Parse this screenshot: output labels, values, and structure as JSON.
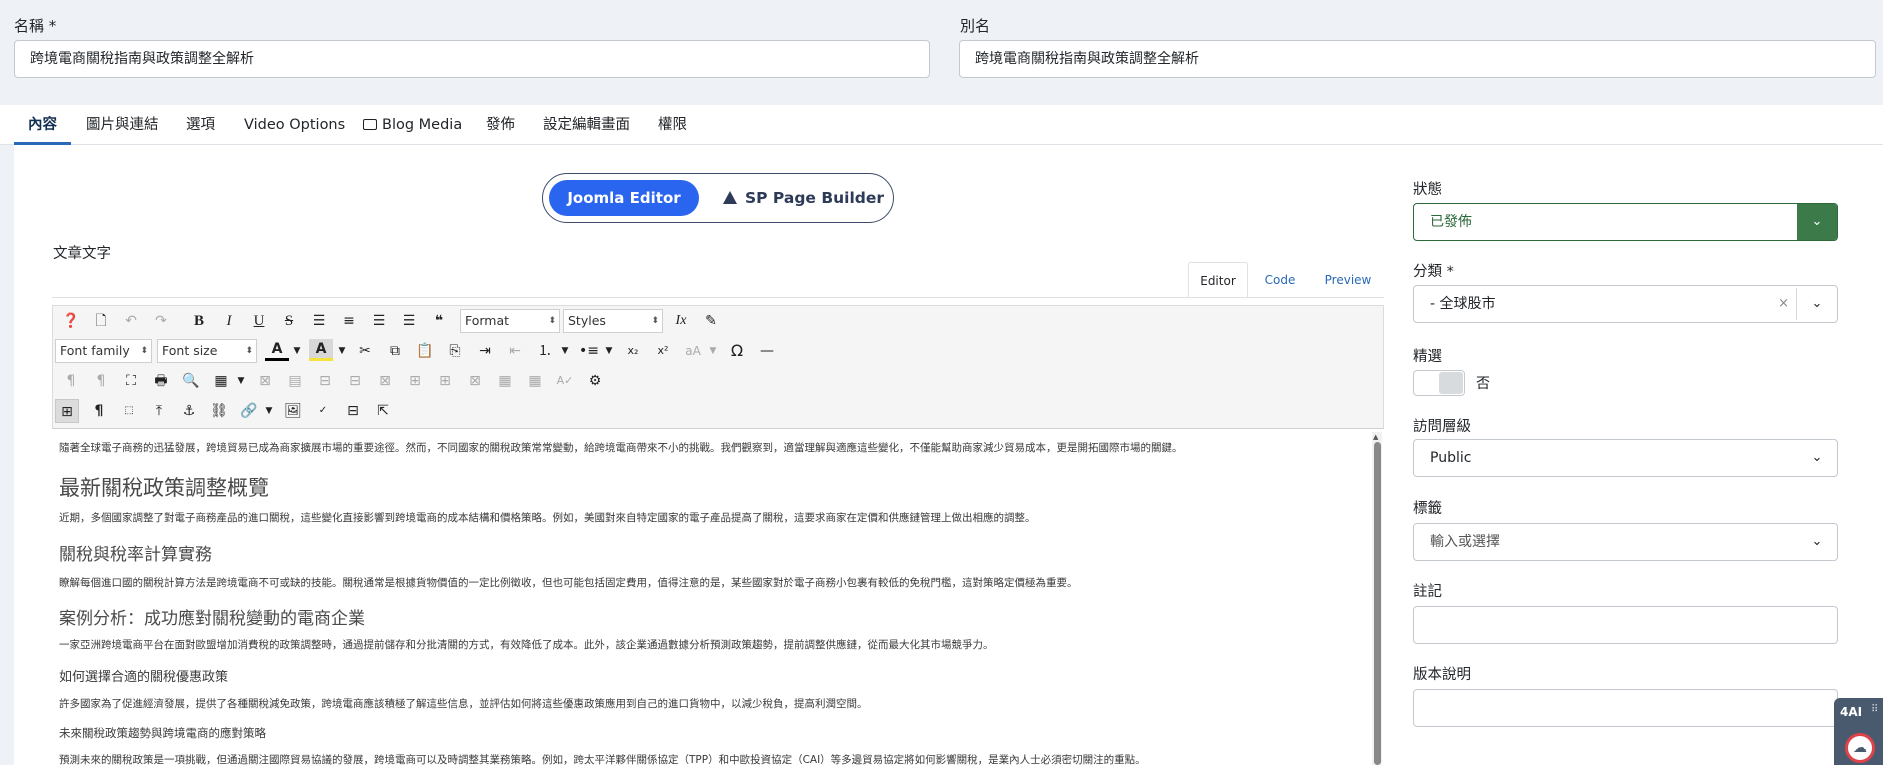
{
  "fields": {
    "title_label": "名稱 *",
    "title_value": "跨境電商關稅指南與政策調整全解析",
    "alias_label": "別名",
    "alias_value": "跨境電商關稅指南與政策調整全解析"
  },
  "tabs": [
    {
      "label": "內容"
    },
    {
      "label": "圖片與連結"
    },
    {
      "label": "選項"
    },
    {
      "label": "Video Options"
    },
    {
      "label": "Blog Media"
    },
    {
      "label": "發佈"
    },
    {
      "label": "設定編輯畫面"
    },
    {
      "label": "權限"
    }
  ],
  "editor_switch": {
    "active": "Joomla Editor",
    "other": "SP Page Builder"
  },
  "article_text_label": "文章文字",
  "editor_modes": [
    "Editor",
    "Code",
    "Preview"
  ],
  "toolbar": {
    "format": "Format",
    "styles": "Styles",
    "font_family": "Font family",
    "font_size": "Font size",
    "font_color_letter": "A",
    "bg_color_letter": "A",
    "omega": "Ω",
    "bold": "B",
    "italic": "I",
    "underline": "U",
    "strike": "S",
    "subscript": "x₂",
    "superscript": "x²",
    "pilcrow": "¶"
  },
  "content": [
    {
      "type": "p",
      "text": "隨著全球電子商務的迅猛發展，跨境貿易已成為商家擴展市場的重要途徑。然而，不同國家的關稅政策常常變動，給跨境電商帶來不小的挑戰。我們觀察到，適當理解與適應這些變化，不僅能幫助商家減少貿易成本，更是開拓國際市場的關鍵。"
    },
    {
      "type": "h2",
      "text": "最新關稅政策調整概覽"
    },
    {
      "type": "p",
      "text": "近期，多個國家調整了對電子商務產品的進口關稅，這些變化直接影響到跨境電商的成本結構和價格策略。例如，美國對來自特定國家的電子產品提高了關稅，這要求商家在定價和供應鏈管理上做出相應的調整。"
    },
    {
      "type": "h3",
      "text": "關稅與稅率計算實務"
    },
    {
      "type": "p",
      "text": "瞭解每個進口國的關稅計算方法是跨境電商不可或缺的技能。關稅通常是根據貨物價值的一定比例徵收，但也可能包括固定費用，值得注意的是，某些國家對於電子商務小包裹有較低的免稅門檻，這對策略定價極為重要。"
    },
    {
      "type": "h3",
      "text": "案例分析：成功應對關稅變動的電商企業"
    },
    {
      "type": "p",
      "text": "一家亞洲跨境電商平台在面對歐盟增加消費稅的政策調整時，通過提前儲存和分批清關的方式，有效降低了成本。此外，該企業通過數據分析預測政策趨勢，提前調整供應鏈，從而最大化其市場競爭力。"
    },
    {
      "type": "h4",
      "text": "如何選擇合適的關稅優惠政策"
    },
    {
      "type": "p",
      "text": "許多國家為了促進經濟發展，提供了各種關稅減免政策，跨境電商應該積極了解這些信息，並評估如何將這些優惠政策應用到自己的進口貨物中，以減少稅負，提高利潤空間。"
    },
    {
      "type": "p",
      "text": "未來關稅政策趨勢與跨境電商的應對策略"
    },
    {
      "type": "p",
      "text": "預測未來的關稅政策是一項挑戰，但通過關注國際貿易協議的發展，跨境電商可以及時調整其業務策略。例如，跨太平洋夥伴關係協定（TPP）和中歐投資協定（CAI）等多邊貿易協定將如何影響關稅，是業內人士必須密切關注的重點。"
    }
  ],
  "sidebar": {
    "status_label": "狀態",
    "status_value": "已發佈",
    "category_label": "分類 *",
    "category_value": "- 全球股市",
    "category_clear": "×",
    "featured_label": "精選",
    "featured_value": "否",
    "access_label": "訪問層級",
    "access_value": "Public",
    "tags_label": "標籤",
    "tags_placeholder": "輸入或選擇",
    "note_label": "註記",
    "note_value": "",
    "version_label": "版本說明",
    "version_value": ""
  },
  "widget": {
    "label": "4AI"
  },
  "colors": {
    "accent": "#2a65f0",
    "status_green": "#3d7a4a",
    "tab_active": "#2a69b8"
  }
}
